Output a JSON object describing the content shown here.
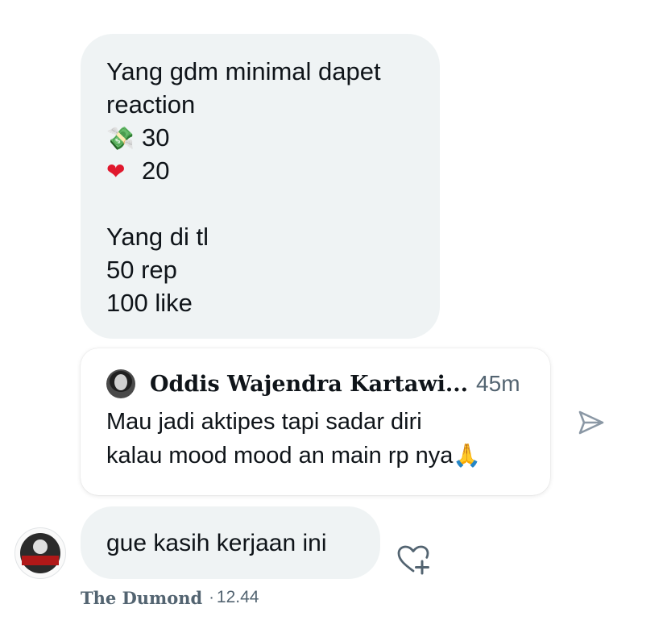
{
  "message_top": {
    "line1": "Yang gdm minimal dapet",
    "line2": "reaction",
    "money_emoji": "💸",
    "money_count": "30",
    "heart_emoji": "❤",
    "heart_count": "20",
    "line5": "Yang di tl",
    "line6": "50 rep",
    "line7": "100 like"
  },
  "quoted_post": {
    "author": "Oddis Wajendra Kartawi...",
    "time": "45m",
    "text_line1": "Mau jadi aktipes tapi sadar diri",
    "text_line2": "kalau mood mood an main rp nya",
    "emoji": "🙏"
  },
  "message_bottom": {
    "text": "gue kasih kerjaan ini"
  },
  "sender": {
    "name": "The Dumond",
    "separator": "·",
    "time": "12.44"
  },
  "icons": {
    "share": "share-arrow-icon",
    "react": "add-reaction-heart-icon"
  },
  "colors": {
    "bubble": "#eff3f4",
    "secondary_text": "#536471",
    "icon": "#8b98a5"
  }
}
